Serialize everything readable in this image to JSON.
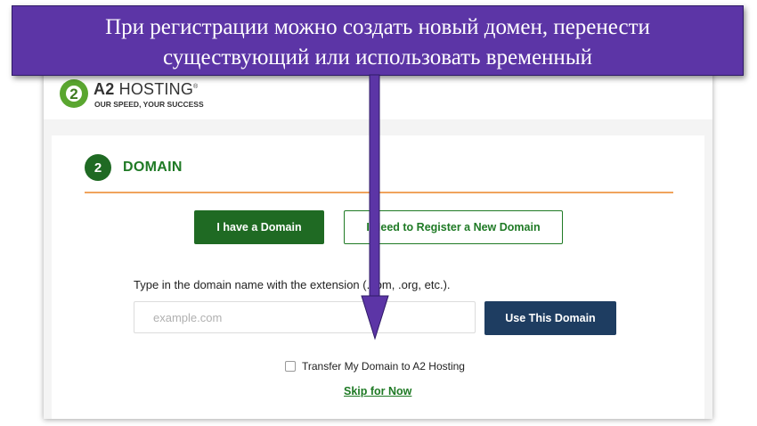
{
  "banner": {
    "line1": "При регистрации можно создать новый домен, перенести",
    "line2": "существующий или использовать временный"
  },
  "brand": {
    "logo_mark": "2",
    "logo_name_bold": "A2",
    "logo_name_rest": " HOSTING",
    "registered": "®",
    "tagline": "OUR SPEED, YOUR SUCCESS"
  },
  "step": {
    "number": "2",
    "title": "DOMAIN"
  },
  "buttons": {
    "have_domain": "I have a Domain",
    "register_new": "I Need to Register a New Domain",
    "use_domain": "Use This Domain"
  },
  "domain_form": {
    "instruction": "Type in the domain name with the extension (.com, .org, etc.).",
    "input_value": "",
    "placeholder": "example.com"
  },
  "transfer": {
    "checked": false,
    "label": "Transfer My Domain to A2 Hosting"
  },
  "skip_link": "Skip for Now",
  "colors": {
    "brand_green": "#1f6a23",
    "accent_orange": "#f0a35c",
    "navy": "#1e3d61",
    "banner_purple": "#5c35a6"
  }
}
